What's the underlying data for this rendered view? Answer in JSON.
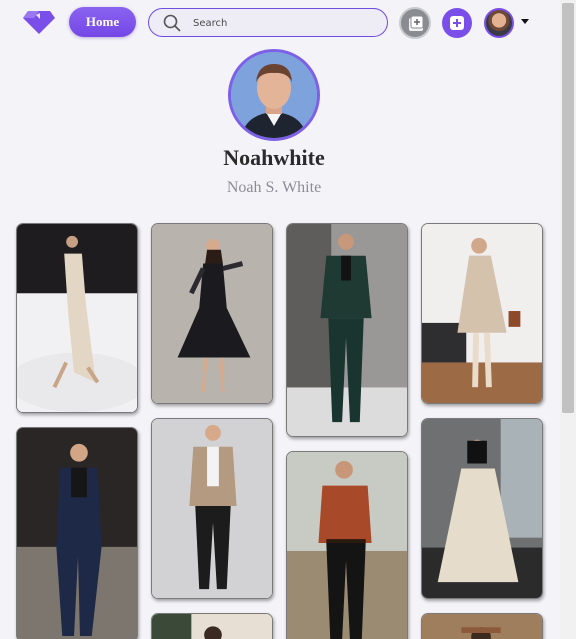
{
  "navbar": {
    "home_label": "Home",
    "search_placeholder": "Search"
  },
  "profile": {
    "username": "Noahwhite",
    "full_name": "Noah S. White"
  },
  "pins": [
    {
      "subject": "woman in ivory satin gown"
    },
    {
      "subject": "woman in black tulle dress"
    },
    {
      "subject": "man in dark green suit"
    },
    {
      "subject": "woman in beige coat"
    },
    {
      "subject": "man in navy suit"
    },
    {
      "subject": "man in tan blazer"
    },
    {
      "subject": "man in rust shirt"
    },
    {
      "subject": "woman in cream trench coat"
    },
    {
      "subject": "woman partially visible"
    },
    {
      "subject": "man partially visible"
    }
  ],
  "colors": {
    "accent": "#7a4ee8",
    "background": "#f4f3f8"
  }
}
